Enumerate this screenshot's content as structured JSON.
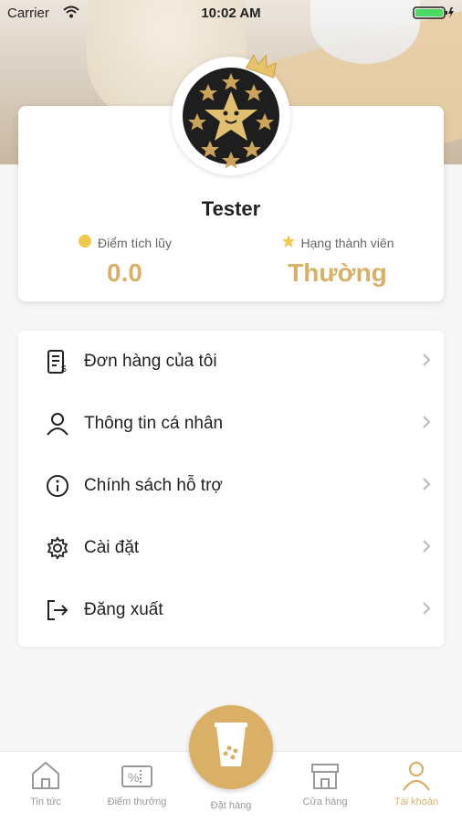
{
  "status_bar": {
    "carrier": "Carrier",
    "time": "10:02 AM"
  },
  "profile": {
    "name": "Tester",
    "points_label": "Điểm tích lũy",
    "points_value": "0.0",
    "rank_label": "Hạng thành viên",
    "rank_value": "Thường"
  },
  "menu": {
    "items": [
      {
        "label": "Đơn hàng của tôi",
        "icon": "receipt-icon"
      },
      {
        "label": "Thông tin cá nhân",
        "icon": "user-icon"
      },
      {
        "label": "Chính sách hỗ trợ",
        "icon": "info-icon"
      },
      {
        "label": "Cài đặt",
        "icon": "gear-icon"
      },
      {
        "label": "Đăng xuất",
        "icon": "logout-icon"
      }
    ]
  },
  "tabs": {
    "items": [
      {
        "label": "Tin tức",
        "icon": "home-icon"
      },
      {
        "label": "Điểm thưởng",
        "icon": "voucher-icon"
      },
      {
        "label": "Đặt hàng",
        "icon": "drink-cup-icon"
      },
      {
        "label": "Cửa hàng",
        "icon": "store-icon"
      },
      {
        "label": "Tài khoản",
        "icon": "user-icon"
      }
    ],
    "active_index": 4
  },
  "colors": {
    "accent": "#d9b066",
    "inactive": "#999999",
    "text": "#222222"
  }
}
